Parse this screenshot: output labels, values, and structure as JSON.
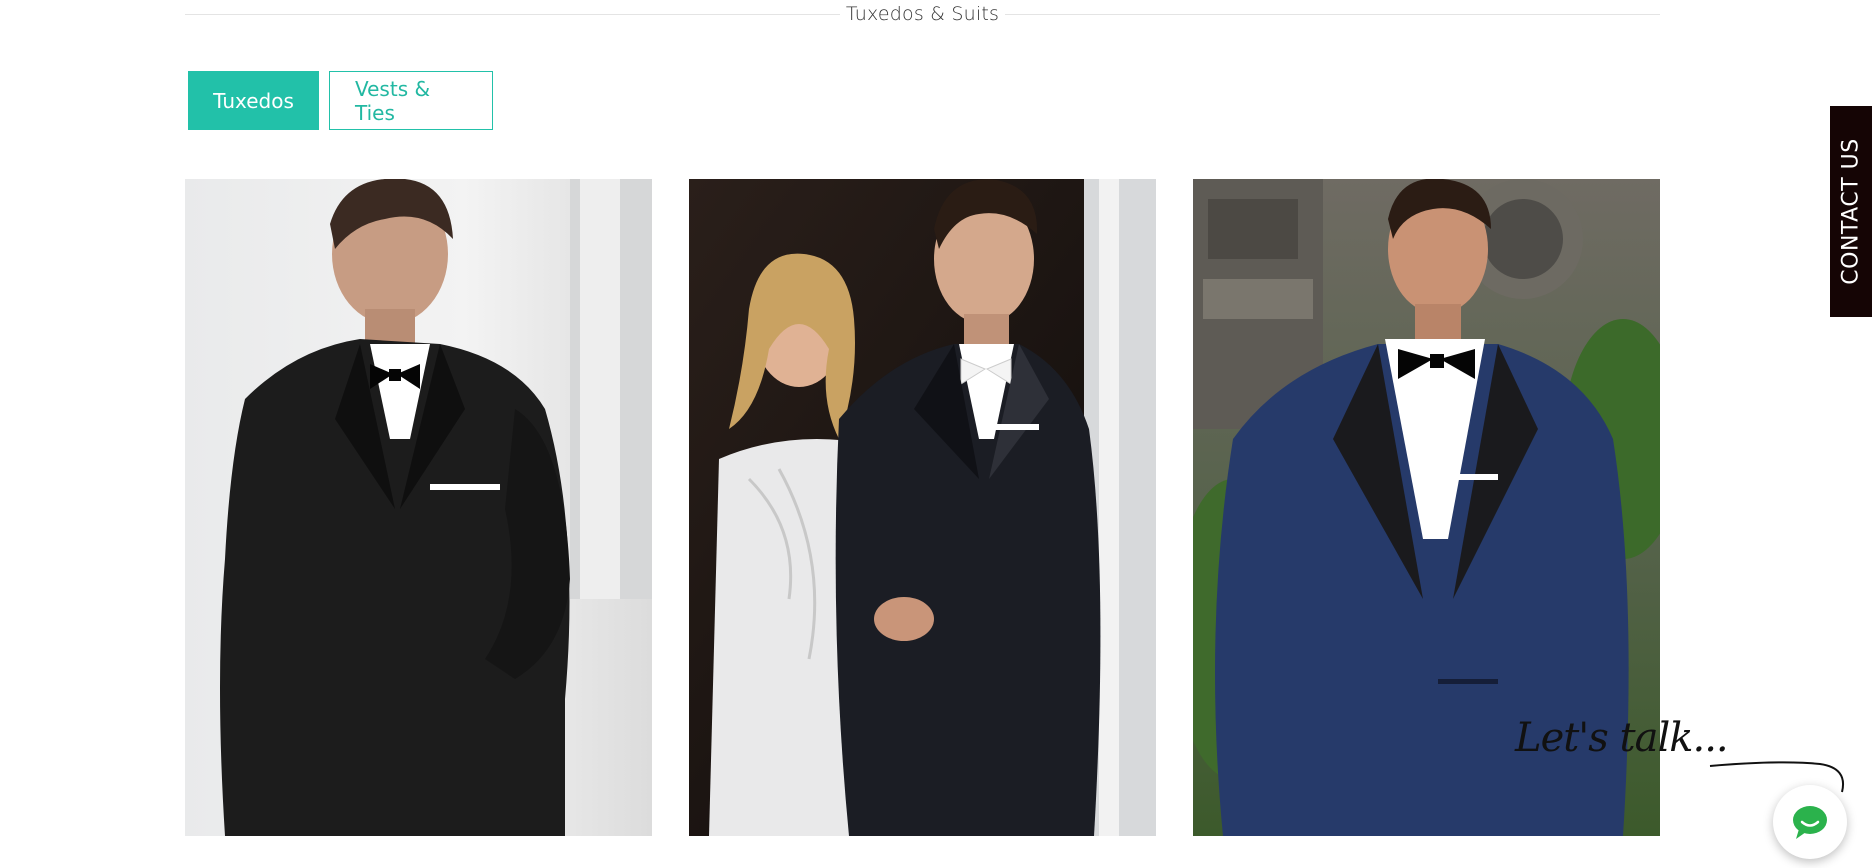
{
  "section": {
    "title": "Tuxedos & Suits"
  },
  "tabs": [
    {
      "label": "Tuxedos",
      "active": true
    },
    {
      "label": "Vests & Ties",
      "active": false
    }
  ],
  "products": [
    {
      "image": "black-tuxedo-photo"
    },
    {
      "image": "couple-black-tuxedo-photo"
    },
    {
      "image": "navy-tuxedo-photo"
    }
  ],
  "contact_tab": {
    "label": "CONTACT US"
  },
  "chat_widget": {
    "label": "Let's talk...",
    "icon": "chat-bubble-icon"
  },
  "colors": {
    "accent": "#22c1a9",
    "contact_bg": "#150505",
    "chat_green": "#2bb24c"
  }
}
